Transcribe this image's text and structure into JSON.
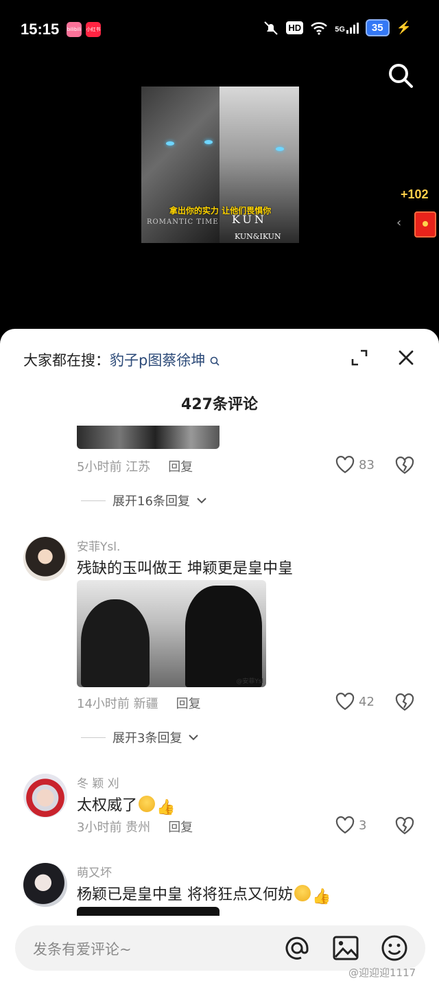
{
  "status_bar": {
    "time": "15:15",
    "app1": "bilibili",
    "app2": "小红书",
    "hd": "HD",
    "signal": "5G",
    "battery": "35"
  },
  "video": {
    "caption": "拿出你的实力 让他们畏惧你",
    "left_text": "ROMANTIC TIME",
    "right_text": "KUN",
    "right_sub": "KUN&IKUN"
  },
  "reward": {
    "amount": "+102"
  },
  "sheet": {
    "trend_prefix": "大家都在搜：",
    "trend_keyword": "豹子p图蔡徐坤",
    "title": "427条评论"
  },
  "comments": [
    {
      "time_loc": "5小时前 江苏",
      "reply": "回复",
      "likes": "83",
      "more_replies": "展开16条回复"
    },
    {
      "user": "安菲Ysl.",
      "text": "残缺的玉叫做王  坤颖更是皇中皇",
      "image_watermark": "@安菲Ysl",
      "time_loc": "14小时前 新疆",
      "reply": "回复",
      "likes": "42",
      "more_replies": "展开3条回复"
    },
    {
      "user": "冬 颖 刈",
      "text": "太权威了",
      "emoji": "👍",
      "time_loc": "3小时前 贵州",
      "reply": "回复",
      "likes": "3"
    },
    {
      "user": "萌又坏",
      "text": "杨颖已是皇中皇 将将狂点又何妨",
      "emoji": "👍"
    }
  ],
  "input": {
    "placeholder": "发条有爱评论~"
  },
  "watermark": "@迎迎迎1117",
  "colors": {
    "keyword": "#2c4a78",
    "reward": "#ffcf4a",
    "battery": "#3478f6"
  }
}
